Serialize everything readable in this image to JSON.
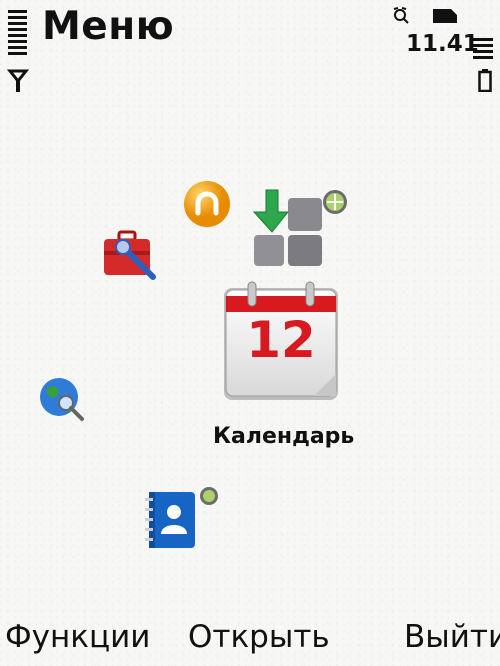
{
  "header": {
    "title": "Меню",
    "clock": "11.41"
  },
  "status": {
    "icons": [
      "signal-strength-icon",
      "antenna-icon",
      "alarm-icon",
      "memory-card-icon",
      "battery-level-icon",
      "battery-icon"
    ]
  },
  "menu": {
    "selected_label": "Календарь",
    "calendar_day": "12",
    "apps": [
      {
        "name": "opera-mini-icon",
        "color": "#f39c12"
      },
      {
        "name": "app-manager-icon",
        "color": "#27a844"
      },
      {
        "name": "tools-icon",
        "color": "#d42a2a"
      },
      {
        "name": "calendar-icon",
        "color": "#d71920"
      },
      {
        "name": "web-icon",
        "color": "#2f7bd8"
      },
      {
        "name": "contacts-icon",
        "color": "#1664c4"
      }
    ]
  },
  "softkeys": {
    "left": "Функции",
    "center": "Открыть",
    "right": "Выйти"
  }
}
